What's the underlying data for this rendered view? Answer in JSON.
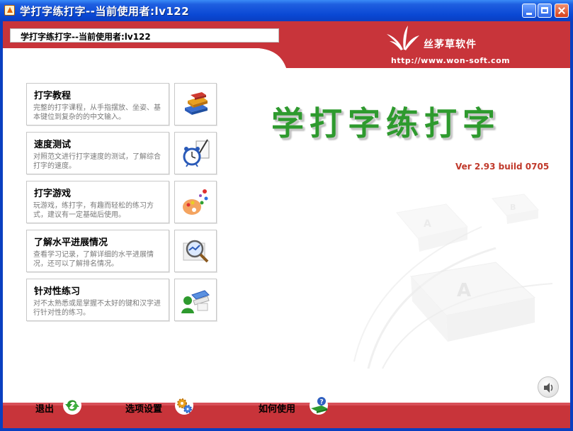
{
  "window": {
    "title": "学打字练打字--当前使用者:lv122"
  },
  "header": {
    "field_text": "学打字练打字--当前使用者:lv122",
    "brand_name": "丝茅草软件",
    "brand_url": "http://www.won-soft.com"
  },
  "main": {
    "big_title": "学打字练打字",
    "version": "Ver 2.93 build 0705"
  },
  "menu": [
    {
      "title": "打字教程",
      "desc": "完整的打字课程，从手指摆放、坐姿、基本键位到复杂的的中文输入。",
      "icon": "books-icon"
    },
    {
      "title": "速度测试",
      "desc": "对照范文进行打字速度的测试，了解综合打字的速度。",
      "icon": "alarm-clock-icon"
    },
    {
      "title": "打字游戏",
      "desc": "玩游戏，练打字，有趣而轻松的练习方式，建议有一定基础后使用。",
      "icon": "palette-icon"
    },
    {
      "title": "了解水平进展情况",
      "desc": "查看学习记录，了解详细的水平进展情况，还可以了解排名情况。",
      "icon": "magnifier-icon"
    },
    {
      "title": "针对性练习",
      "desc": "对不太熟悉或是掌握不太好的键和汉字进行针对性的练习。",
      "icon": "user-keyboard-icon"
    }
  ],
  "bottom": {
    "exit_label": "退出",
    "settings_label": "选项设置",
    "help_label": "如何使用"
  },
  "colors": {
    "banner_red": "#c8343a",
    "title_green": "#2e9a2e",
    "version_red": "#c0392b"
  }
}
